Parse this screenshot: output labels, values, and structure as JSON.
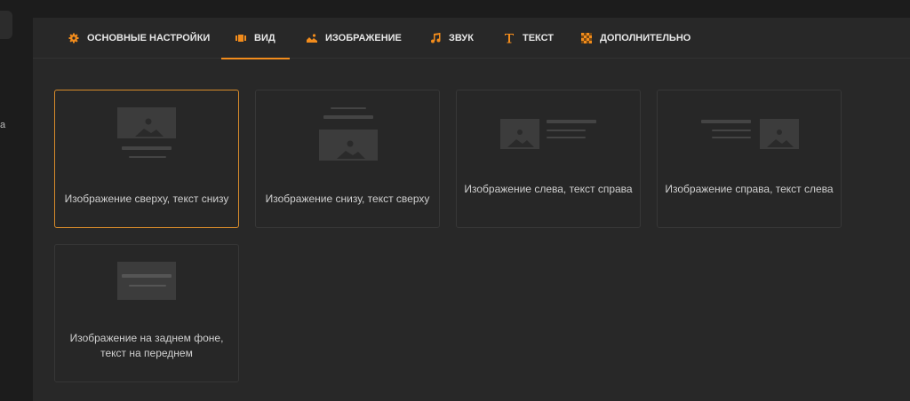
{
  "sidebar": {
    "fragment": "а"
  },
  "tabs": [
    {
      "label": "ОСНОВНЫЕ НАСТРОЙКИ",
      "icon": "gear-icon",
      "active": false
    },
    {
      "label": "ВИД",
      "icon": "layout-icon",
      "active": true
    },
    {
      "label": "ИЗОБРАЖЕНИЕ",
      "icon": "image-icon",
      "active": false
    },
    {
      "label": "ЗВУК",
      "icon": "music-note-icon",
      "active": false
    },
    {
      "label": "ТЕКСТ",
      "icon": "text-icon",
      "active": false
    },
    {
      "label": "ДОПОЛНИТЕЛЬНО",
      "icon": "checker-icon",
      "active": false
    }
  ],
  "layouts": [
    {
      "label": "Изображение сверху, текст снизу",
      "selected": true
    },
    {
      "label": "Изображение снизу, текст сверху",
      "selected": false
    },
    {
      "label": "Изображение слева, текст справа",
      "selected": false
    },
    {
      "label": "Изображение справа, текст слева",
      "selected": false
    },
    {
      "label_line1": "Изображение на заднем фоне,",
      "label_line2": "текст на переднем",
      "selected": false
    }
  ],
  "colors": {
    "accent": "#f28c1c",
    "background": "#282828",
    "card_border": "#373737"
  }
}
